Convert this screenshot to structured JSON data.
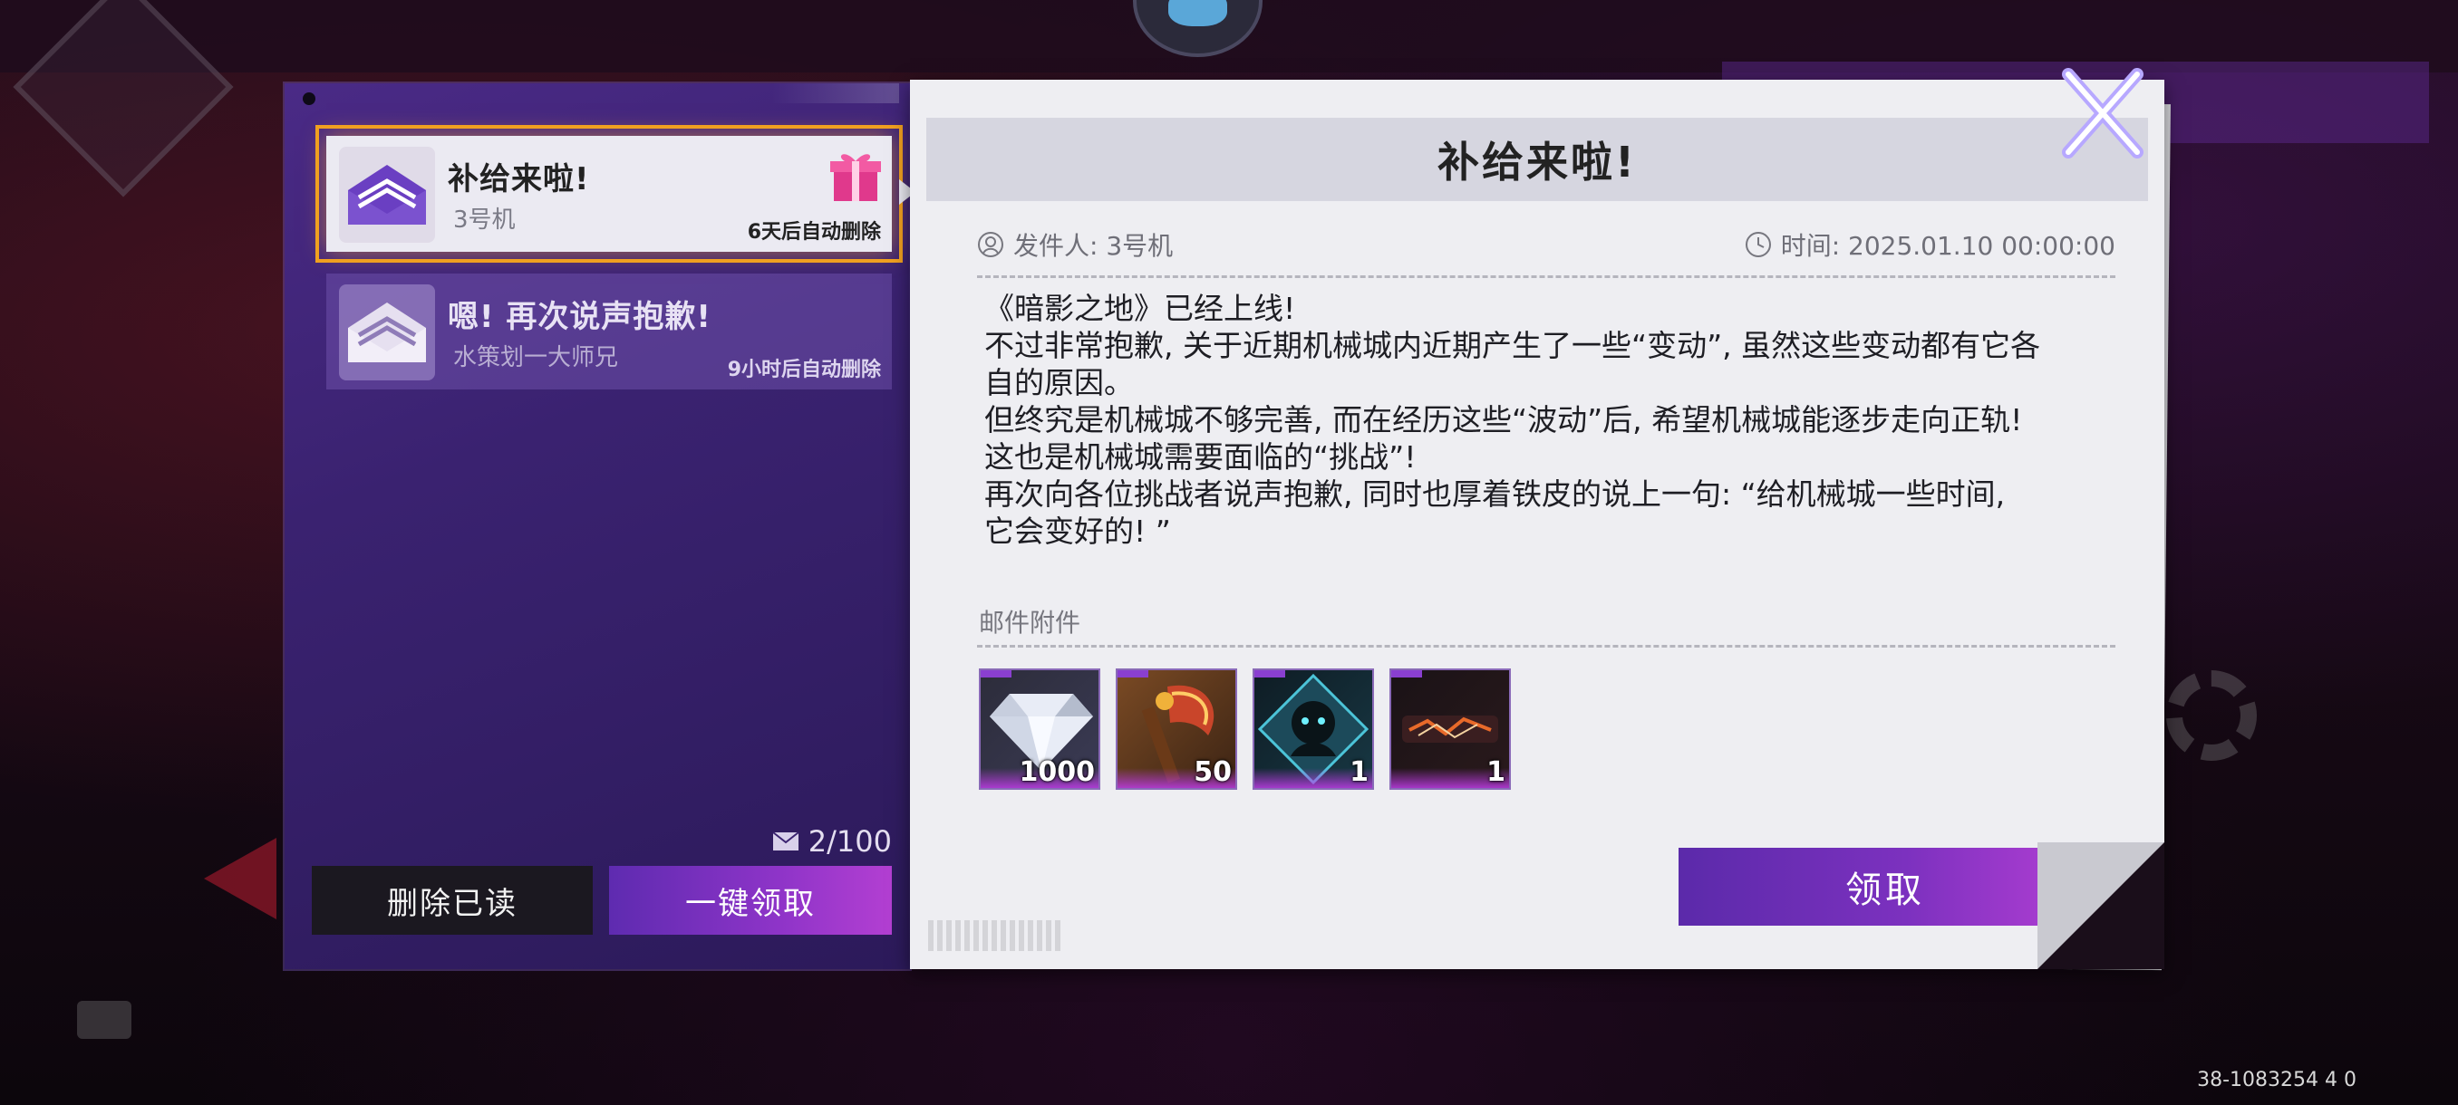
{
  "left_panel": {
    "mails": [
      {
        "title": "补给来啦!",
        "sender": "3号机",
        "expire": "6天后自动删除",
        "selected": true,
        "has_gift": true
      },
      {
        "title": "嗯! 再次说声抱歉!",
        "sender": "水策划一大师兄",
        "expire": "9小时后自动删除",
        "selected": false,
        "has_gift": false
      }
    ],
    "mail_count": "2/100",
    "delete_read_label": "删除已读",
    "claim_all_label": "一键领取"
  },
  "detail": {
    "title": "补给来啦!",
    "sender_label": "发件人: 3号机",
    "time_label": "时间: 2025.01.10 00:00:00",
    "body_lines": [
      "《暗影之地》已经上线!",
      "不过非常抱歉, 关于近期机械城内近期产生了一些“变动”, 虽然这些变动都有它各",
      "自的原因。",
      "但终究是机械城不够完善, 而在经历这些“波动”后, 希望机械城能逐步走向正轨!",
      "这也是机械城需要面临的“挑战”!",
      "再次向各位挑战者说声抱歉, 同时也厚着铁皮的说上一句: “给机械城一些时间,",
      "它会变好的! ”"
    ],
    "attachments_label": "邮件附件",
    "attachments": [
      {
        "icon": "diamond-icon",
        "quantity": "1000"
      },
      {
        "icon": "axe-icon",
        "quantity": "50"
      },
      {
        "icon": "shadow-character-icon",
        "quantity": "1"
      },
      {
        "icon": "title-badge-icon",
        "quantity": "1"
      }
    ],
    "claim_label": "领取"
  },
  "footer": {
    "id_text": "38-1083254   4   0"
  },
  "colors": {
    "accent_purple": "#7c31bf",
    "highlight_orange": "#f0a020",
    "panel_purple": "#3a2270"
  }
}
